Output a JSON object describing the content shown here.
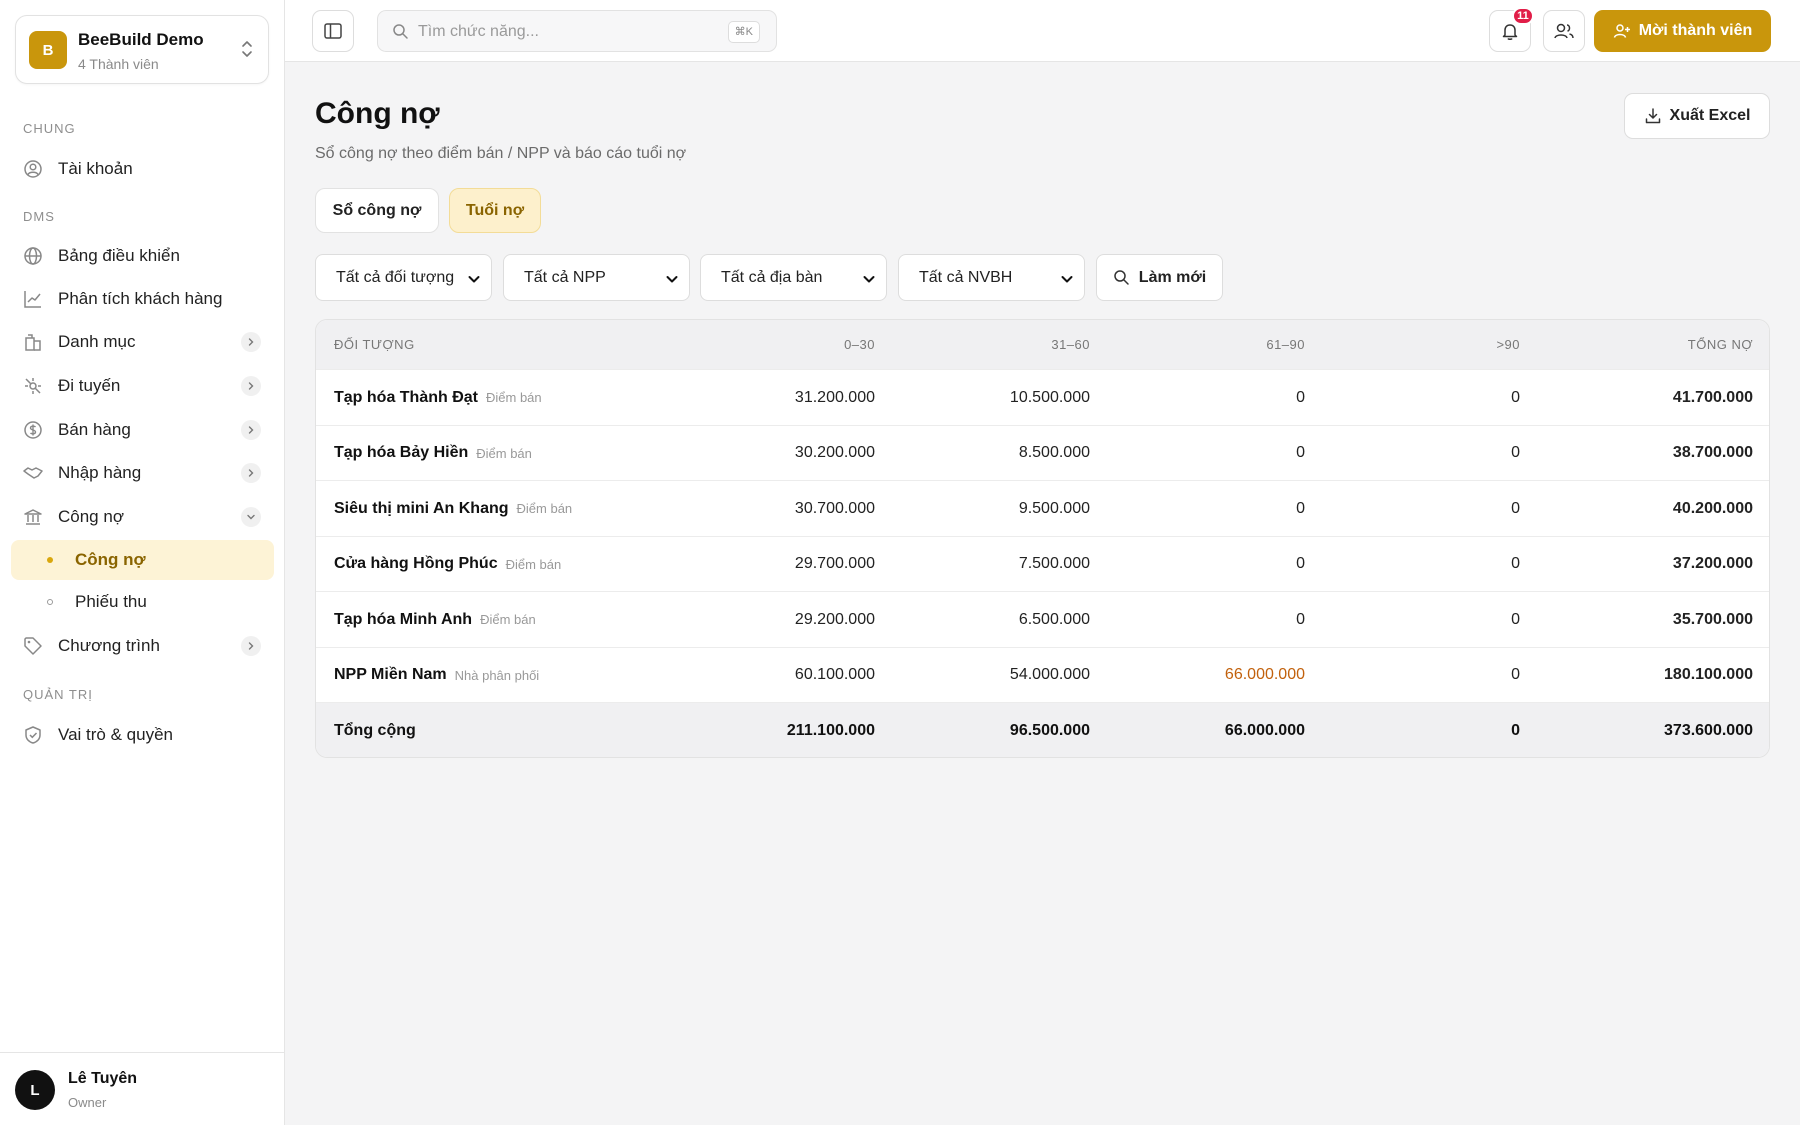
{
  "org": {
    "logo_letter": "B",
    "name": "BeeBuild Demo",
    "members": "4 Thành viên"
  },
  "sidebar": {
    "sections": [
      "CHUNG",
      "DMS",
      "QUẢN TRỊ"
    ],
    "account": "Tài khoản",
    "items": [
      "Bảng điều khiển",
      "Phân tích khách hàng",
      "Danh mục",
      "Đi tuyến",
      "Bán hàng",
      "Nhập hàng",
      "Công nợ"
    ],
    "sub_items": [
      "Công nợ",
      "Phiếu thu"
    ],
    "program": "Chương trình",
    "roles": "Vai trò & quyền"
  },
  "user": {
    "initial": "L",
    "name": "Lê Tuyên",
    "role": "Owner"
  },
  "topbar": {
    "search_placeholder": "Tìm chức năng...",
    "shortcut": "⌘K",
    "notif_count": "11",
    "invite_label": "Mời thành viên"
  },
  "page": {
    "title": "Công nợ",
    "subtitle": "Sổ công nợ theo điểm bán / NPP và báo cáo tuổi nợ",
    "export_label": "Xuất Excel",
    "tabs": [
      "Sổ công nợ",
      "Tuổi nợ"
    ]
  },
  "filters": {
    "object": "Tất cả đối tượng",
    "npp": "Tất cả NPP",
    "area": "Tất cả địa bàn",
    "staff": "Tất cả NVBH",
    "refresh": "Làm mới"
  },
  "table": {
    "headers": [
      "ĐỐI TƯỢNG",
      "0–30",
      "31–60",
      "61–90",
      ">90",
      "TỔNG NỢ"
    ],
    "rows": [
      {
        "name": "Tạp hóa Thành Đạt",
        "type": "Điểm bán",
        "a": "31.200.000",
        "b": "10.500.000",
        "c": "0",
        "d": "0",
        "total": "41.700.000"
      },
      {
        "name": "Tạp hóa Bảy Hiền",
        "type": "Điểm bán",
        "a": "30.200.000",
        "b": "8.500.000",
        "c": "0",
        "d": "0",
        "total": "38.700.000"
      },
      {
        "name": "Siêu thị mini An Khang",
        "type": "Điểm bán",
        "a": "30.700.000",
        "b": "9.500.000",
        "c": "0",
        "d": "0",
        "total": "40.200.000"
      },
      {
        "name": "Cửa hàng Hồng Phúc",
        "type": "Điểm bán",
        "a": "29.700.000",
        "b": "7.500.000",
        "c": "0",
        "d": "0",
        "total": "37.200.000"
      },
      {
        "name": "Tạp hóa Minh Anh",
        "type": "Điểm bán",
        "a": "29.200.000",
        "b": "6.500.000",
        "c": "0",
        "d": "0",
        "total": "35.700.000"
      },
      {
        "name": "NPP Miền Nam",
        "type": "Nhà phân phối",
        "a": "60.100.000",
        "b": "54.000.000",
        "c": "66.000.000",
        "d": "0",
        "total": "180.100.000"
      }
    ],
    "footer": {
      "label": "Tổng cộng",
      "a": "211.100.000",
      "b": "96.500.000",
      "c": "66.000.000",
      "d": "0",
      "total": "373.600.000"
    }
  },
  "colors": {
    "accent": "#c9960c",
    "accent_soft": "#fdf0cc",
    "warning_text": "#c2610c",
    "badge": "#e11d48"
  }
}
